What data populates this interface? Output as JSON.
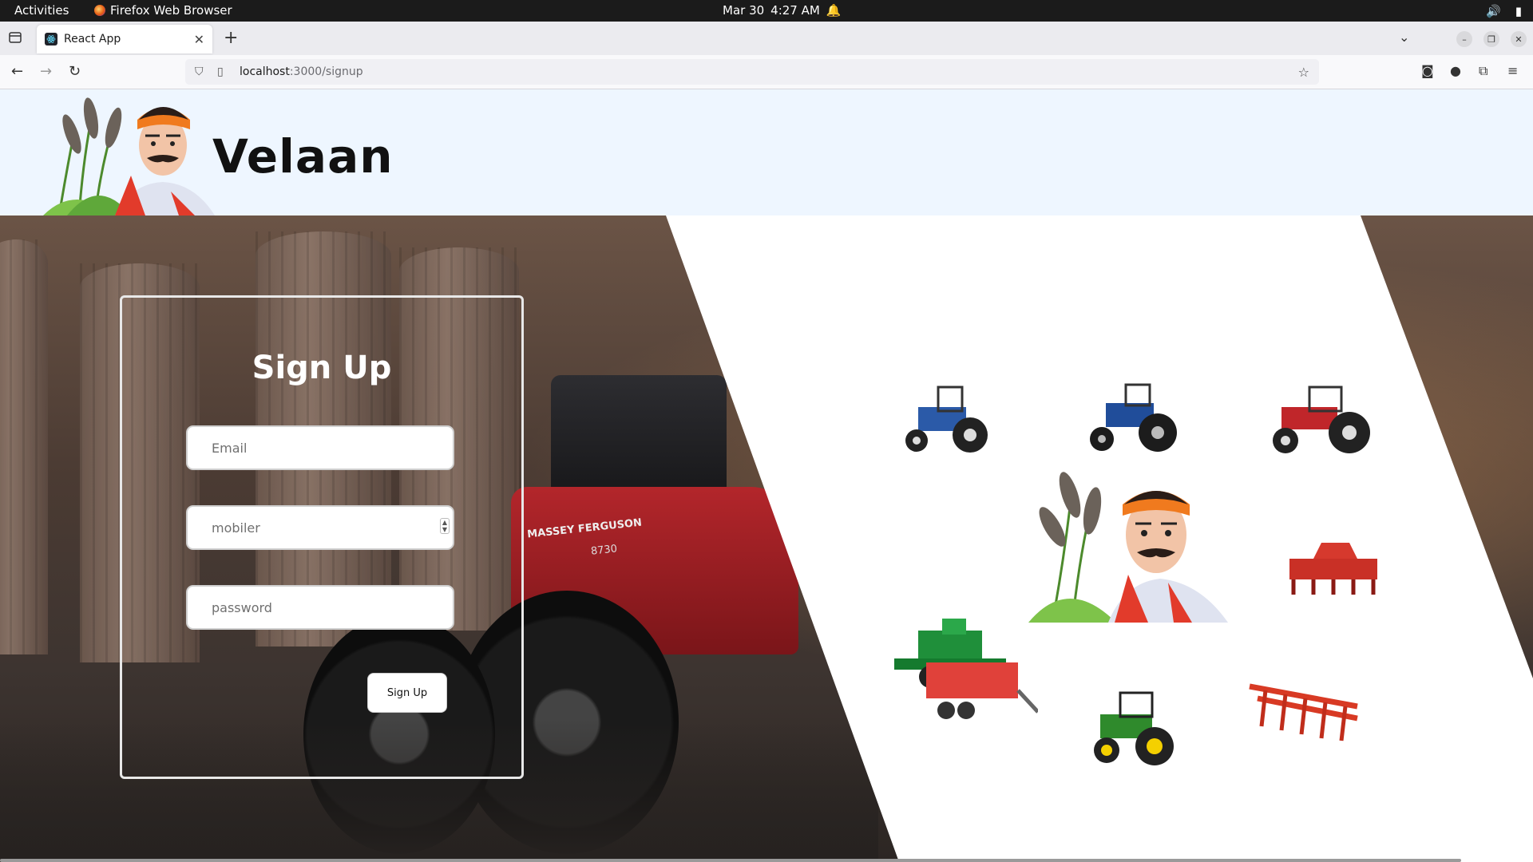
{
  "topbar": {
    "activities": "Activities",
    "app_name": "Firefox Web Browser",
    "date": "Mar 30",
    "time": "4:27 AM"
  },
  "browser": {
    "tab_title": "React App",
    "url_host": "localhost",
    "url_path": ":3000/signup"
  },
  "page": {
    "brand": "Velaan",
    "form": {
      "title": "Sign Up",
      "email_placeholder": "Email",
      "mobile_placeholder": "mobiler",
      "password_placeholder": "password",
      "submit_label": "Sign Up"
    },
    "machine_labels": {
      "tractor_brand": "MASSEY FERGUSON",
      "tractor_model": "8730"
    }
  },
  "colors": {
    "header_bg": "#eef6ff",
    "tractor_red": "#b3262b",
    "turban_orange": "#f07a1e"
  }
}
